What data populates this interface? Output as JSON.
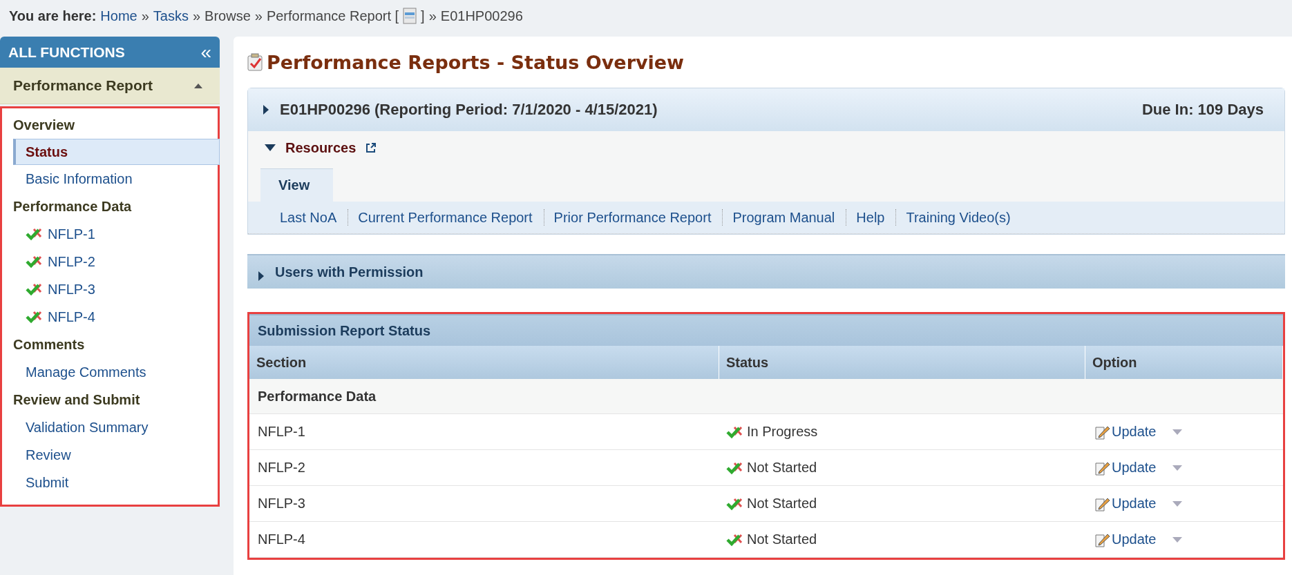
{
  "breadcrumb": {
    "label": "You are here:",
    "crumbs": [
      {
        "text": "Home",
        "kind": "link"
      },
      {
        "text": "Tasks",
        "kind": "link"
      },
      {
        "text": "Browse",
        "kind": "text"
      },
      {
        "text": "Performance Report [",
        "kind": "text",
        "icon": true,
        "after": "]"
      },
      {
        "text": "E01HP00296",
        "kind": "current"
      }
    ],
    "separator": "»"
  },
  "sidebar": {
    "title": "ALL FUNCTIONS",
    "collapse": "«",
    "section": {
      "title": "Performance Report",
      "expanded": true
    },
    "groups": [
      {
        "title": "Overview",
        "items": [
          {
            "label": "Status",
            "selected": true,
            "kind": "link"
          },
          {
            "label": "Basic Information",
            "selected": false,
            "kind": "link"
          }
        ]
      },
      {
        "title": "Performance Data",
        "items": [
          {
            "label": "NFLP-1",
            "selected": false,
            "kind": "status"
          },
          {
            "label": "NFLP-2",
            "selected": false,
            "kind": "status"
          },
          {
            "label": "NFLP-3",
            "selected": false,
            "kind": "status"
          },
          {
            "label": "NFLP-4",
            "selected": false,
            "kind": "status"
          }
        ]
      },
      {
        "title": "Comments",
        "items": [
          {
            "label": "Manage Comments",
            "selected": false,
            "kind": "link"
          }
        ]
      },
      {
        "title": "Review and Submit",
        "items": [
          {
            "label": "Validation Summary",
            "selected": false,
            "kind": "link"
          },
          {
            "label": "Review",
            "selected": false,
            "kind": "link"
          },
          {
            "label": "Submit",
            "selected": false,
            "kind": "link"
          }
        ]
      }
    ]
  },
  "page_title": "Performance Reports - Status Overview",
  "grant_panel": {
    "title": "E01HP00296 (Reporting Period: 7/1/2020 - 4/15/2021)",
    "expanded": false,
    "due": "Due In: 109 Days"
  },
  "resources": {
    "title": "Resources",
    "expanded": true,
    "tabs": [
      {
        "label": "View",
        "selected": true
      }
    ],
    "links": [
      "Last NoA",
      "Current Performance Report",
      "Prior Performance Report",
      "Program Manual",
      "Help",
      "Training Video(s)"
    ]
  },
  "permissions_panel": {
    "title": "Users with Permission",
    "expanded": false
  },
  "status_table": {
    "title": "Submission Report Status",
    "columns": [
      "Section",
      "Status",
      "Option"
    ],
    "group": "Performance Data",
    "rows": [
      {
        "section": "NFLP-1",
        "status": "In Progress",
        "option": "Update"
      },
      {
        "section": "NFLP-2",
        "status": "Not Started",
        "option": "Update"
      },
      {
        "section": "NFLP-3",
        "status": "Not Started",
        "option": "Update"
      },
      {
        "section": "NFLP-4",
        "status": "Not Started",
        "option": "Update"
      }
    ]
  }
}
